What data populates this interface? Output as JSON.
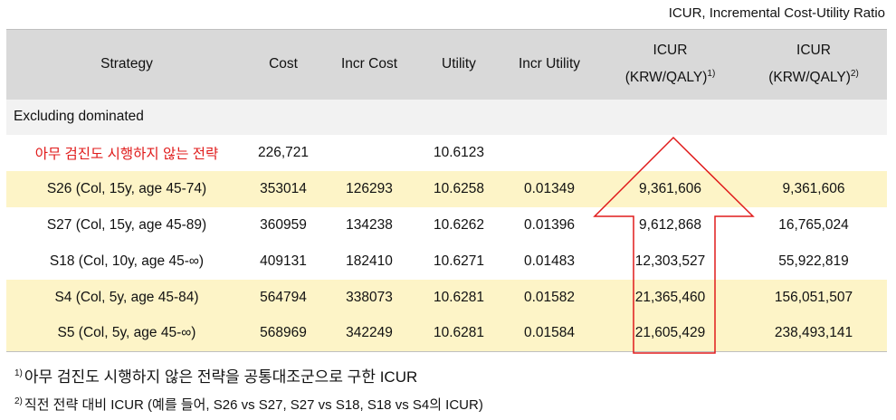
{
  "caption": "ICUR, Incremental Cost-Utility Ratio",
  "headers": {
    "strategy": "Strategy",
    "cost": "Cost",
    "incr_cost": "Incr Cost",
    "utility": "Utility",
    "incr_utility": "Incr Utility",
    "icur1_line1": "ICUR",
    "icur1_line2": "(KRW/QALY)",
    "icur1_sup": "1)",
    "icur2_line1": "ICUR",
    "icur2_line2": "(KRW/QALY)",
    "icur2_sup": "2)"
  },
  "section_label": "Excluding dominated",
  "rows": [
    {
      "strategy": "아무 검진도 시행하지 않는 전략",
      "cost": "226,721",
      "incr_cost": "",
      "utility": "10.6123",
      "incr_utility": "",
      "icur1": "",
      "icur2": ""
    },
    {
      "strategy": "S26 (Col, 15y, age 45-74)",
      "cost": "353014",
      "incr_cost": "126293",
      "utility": "10.6258",
      "incr_utility": "0.01349",
      "icur1": "9,361,606",
      "icur2": "9,361,606"
    },
    {
      "strategy": "S27 (Col, 15y, age 45-89)",
      "cost": "360959",
      "incr_cost": "134238",
      "utility": "10.6262",
      "incr_utility": "0.01396",
      "icur1": "9,612,868",
      "icur2": "16,765,024"
    },
    {
      "strategy": "S18 (Col, 10y, age 45-∞)",
      "cost": "409131",
      "incr_cost": "182410",
      "utility": "10.6271",
      "incr_utility": "0.01483",
      "icur1": "12,303,527",
      "icur2": "55,922,819"
    },
    {
      "strategy": "S4 (Col, 5y, age 45-84)",
      "cost": "564794",
      "incr_cost": "338073",
      "utility": "10.6281",
      "incr_utility": "0.01582",
      "icur1": "21,365,460",
      "icur2": "156,051,507"
    },
    {
      "strategy": "S5 (Col, 5y, age 45-∞)",
      "cost": "568969",
      "incr_cost": "342249",
      "utility": "10.6281",
      "incr_utility": "0.01584",
      "icur1": "21,605,429",
      "icur2": "238,493,141"
    }
  ],
  "footnotes": {
    "fn1_mark": "1)",
    "fn1_text": "아무 검진도 시행하지 않은 전략을 공통대조군으로 구한 ICUR",
    "fn2_mark": "2)",
    "fn2_text": "직전 전략 대비 ICUR (예를 들어, S26 vs S27, S27 vs S18, S18 vs S4의 ICUR)"
  },
  "colors": {
    "header_bg": "#d9d9d9",
    "section_bg": "#f2f2f2",
    "highlight_bg": "#fdf4c7",
    "accent_red": "#e01b1b"
  }
}
